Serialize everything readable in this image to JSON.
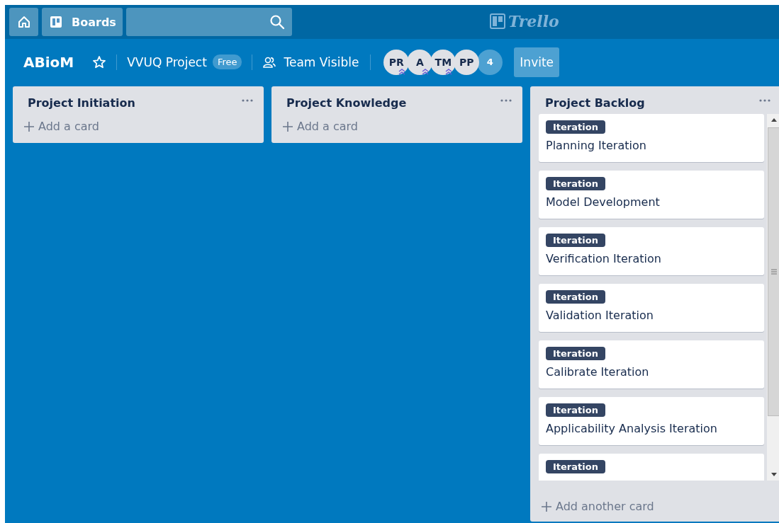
{
  "header": {
    "logo": "Trello",
    "boards_button": "Boards"
  },
  "board": {
    "title": "ABioM",
    "starred": false,
    "team": "VVUQ Project",
    "plan_badge": "Free",
    "visibility": "Team Visible",
    "members": [
      {
        "initials": "PR",
        "admin": true
      },
      {
        "initials": "A",
        "admin": true
      },
      {
        "initials": "TM",
        "admin": true
      },
      {
        "initials": "PP",
        "admin": false
      }
    ],
    "member_count": "4",
    "invite_button": "Invite"
  },
  "lists": [
    {
      "title": "Project Initiation",
      "add_label": "Add a card"
    },
    {
      "title": "Project Knowledge",
      "add_label": "Add a card"
    },
    {
      "title": "Project Backlog",
      "add_label": "Add another card",
      "cards": [
        {
          "label": "Iteration",
          "title": "Planning Iteration"
        },
        {
          "label": "Iteration",
          "title": "Model Development"
        },
        {
          "label": "Iteration",
          "title": "Verification Iteration"
        },
        {
          "label": "Iteration",
          "title": "Validation Iteration"
        },
        {
          "label": "Iteration",
          "title": "Calibrate Iteration"
        },
        {
          "label": "Iteration",
          "title": "Applicability Analysis Iteration"
        },
        {
          "label": "Iteration"
        }
      ]
    }
  ]
}
